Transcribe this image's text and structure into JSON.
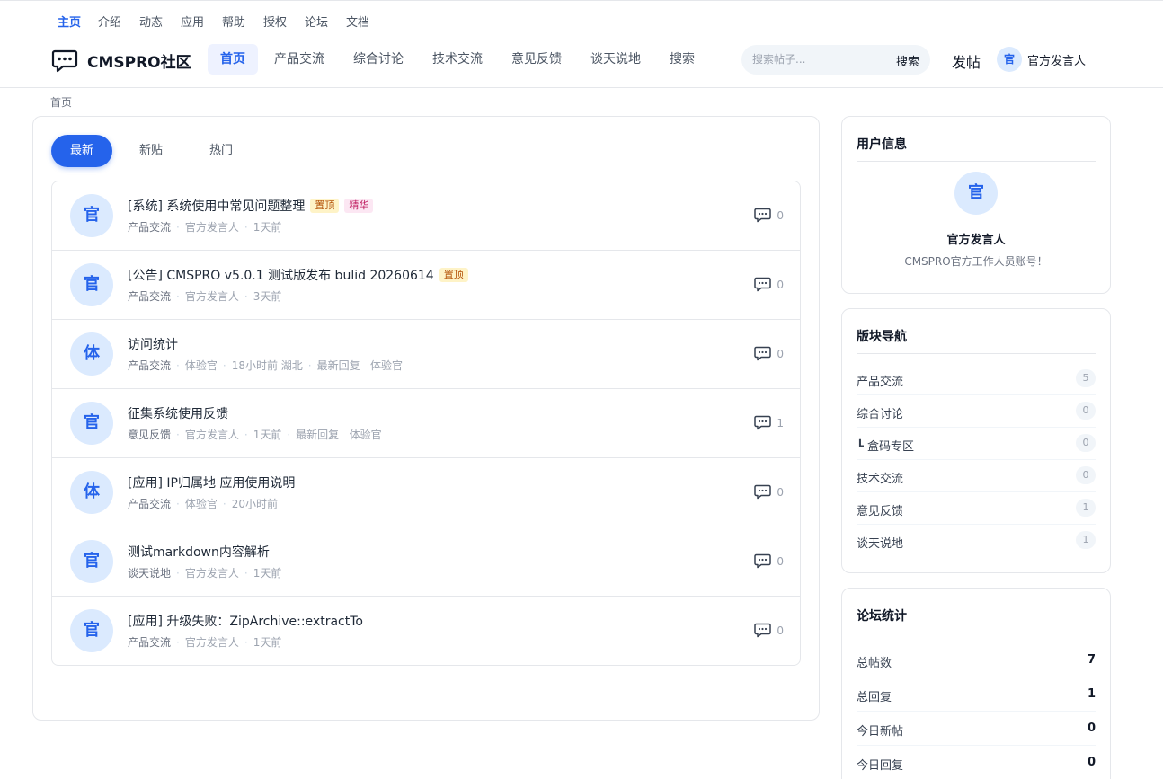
{
  "topnav": [
    "主页",
    "介绍",
    "动态",
    "应用",
    "帮助",
    "授权",
    "论坛",
    "文档"
  ],
  "brand": "CMSPRO社区",
  "mainnav": [
    "首页",
    "产品交流",
    "综合讨论",
    "技术交流",
    "意见反馈",
    "谈天说地",
    "搜索"
  ],
  "search": {
    "placeholder": "搜索帖子...",
    "button": "搜索"
  },
  "post_button": "发帖",
  "current_user": {
    "avatar": "官",
    "name": "官方发言人"
  },
  "breadcrumb": "首页",
  "tabs": [
    "最新",
    "新贴",
    "热门"
  ],
  "threads": [
    {
      "avatar": "官",
      "title": "[系统] 系统使用中常见问题整理",
      "tags": [
        "置顶",
        "精华"
      ],
      "category": "产品交流",
      "author": "官方发言人",
      "time": "1天前",
      "extra": "",
      "comments": "0"
    },
    {
      "avatar": "官",
      "title": "[公告] CMSPRO v5.0.1 测试版发布 bulid 20260614",
      "tags": [
        "置顶"
      ],
      "category": "产品交流",
      "author": "官方发言人",
      "time": "3天前",
      "extra": "",
      "comments": "0"
    },
    {
      "avatar": "体",
      "title": "访问统计",
      "tags": [],
      "category": "产品交流",
      "author": "体验官",
      "time": "18小时前 湖北",
      "extra": "最新回复   体验官",
      "comments": "0"
    },
    {
      "avatar": "官",
      "title": "征集系统使用反馈",
      "tags": [],
      "category": "意见反馈",
      "author": "官方发言人",
      "time": "1天前",
      "extra": "最新回复   体验官",
      "comments": "1"
    },
    {
      "avatar": "体",
      "title": "[应用] IP归属地 应用使用说明",
      "tags": [],
      "category": "产品交流",
      "author": "体验官",
      "time": "20小时前",
      "extra": "",
      "comments": "0"
    },
    {
      "avatar": "官",
      "title": "测试markdown内容解析",
      "tags": [],
      "category": "谈天说地",
      "author": "官方发言人",
      "time": "1天前",
      "extra": "",
      "comments": "0"
    },
    {
      "avatar": "官",
      "title": "[应用] 升级失败：ZipArchive::extractTo",
      "tags": [],
      "category": "产品交流",
      "author": "官方发言人",
      "time": "1天前",
      "extra": "",
      "comments": "0"
    }
  ],
  "sidebar": {
    "user_info": {
      "title": "用户信息",
      "avatar": "官",
      "name": "官方发言人",
      "desc": "CMSPRO官方工作人员账号！"
    },
    "boards": {
      "title": "版块导航",
      "items": [
        {
          "label": "产品交流",
          "count": "5"
        },
        {
          "label": "综合讨论",
          "count": "0"
        },
        {
          "label": "┗ 盒码专区",
          "count": "0"
        },
        {
          "label": "技术交流",
          "count": "0"
        },
        {
          "label": "意见反馈",
          "count": "1"
        },
        {
          "label": "谈天说地",
          "count": "1"
        }
      ]
    },
    "stats": {
      "title": "论坛统计",
      "items": [
        {
          "label": "总帖数",
          "value": "7"
        },
        {
          "label": "总回复",
          "value": "1"
        },
        {
          "label": "今日新帖",
          "value": "0"
        },
        {
          "label": "今日回复",
          "value": "0"
        }
      ]
    }
  },
  "colors": {
    "accent": "#2563eb",
    "avatar_bg": "#dbeafe",
    "tag_top_bg": "#fef3c7",
    "tag_best_bg": "#fce7f3"
  }
}
